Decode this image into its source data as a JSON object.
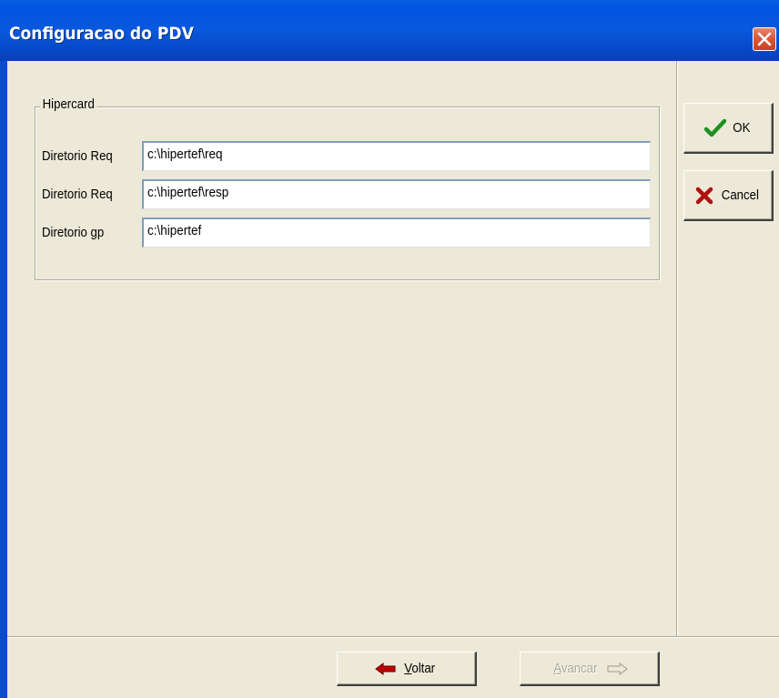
{
  "window": {
    "title": "Configuracao do PDV"
  },
  "group": {
    "legend": "Hipercard",
    "fields": [
      {
        "label": "Diretorio Req",
        "value": "c:\\hipertef\\req"
      },
      {
        "label": "Diretorio Req",
        "value": "c:\\hipertef\\resp"
      },
      {
        "label": "Diretorio gp",
        "value": "c:\\hipertef"
      }
    ]
  },
  "side_buttons": {
    "ok_label": "OK",
    "cancel_label": "Cancel"
  },
  "nav_buttons": {
    "back_mnemonic": "V",
    "back_rest": "oltar",
    "next_mnemonic": "A",
    "next_rest": "vancar"
  },
  "colors": {
    "title_bar": "#0054e3",
    "face": "#ece9d8",
    "close_button": "#d95a3c",
    "ok_check": "#1f8f1f",
    "cancel_x": "#b01010",
    "back_arrow": "#c00000"
  },
  "icons": {
    "close": "close-icon",
    "ok": "checkmark-icon",
    "cancel": "x-icon",
    "back": "arrow-left-icon",
    "next": "arrow-right-icon"
  }
}
